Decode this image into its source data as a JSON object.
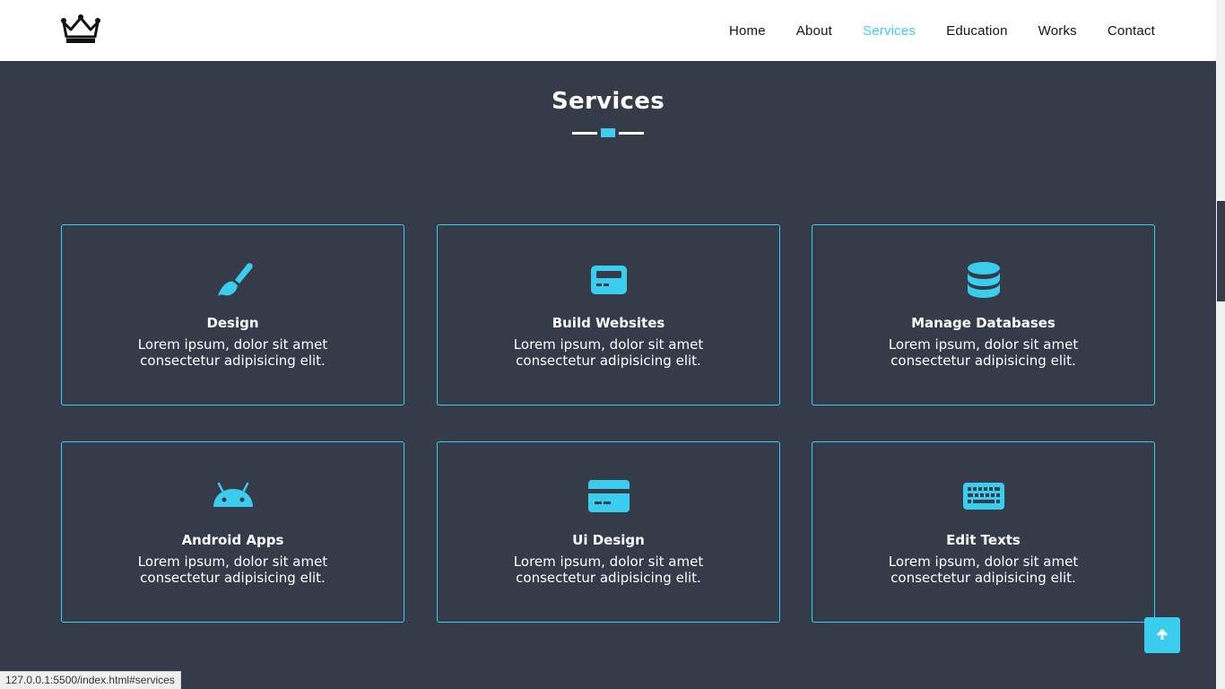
{
  "header": {
    "logo_icon": "crown-icon",
    "nav": [
      {
        "label": "Home",
        "active": false
      },
      {
        "label": "About",
        "active": false
      },
      {
        "label": "Services",
        "active": true
      },
      {
        "label": "Education",
        "active": false
      },
      {
        "label": "Works",
        "active": false
      },
      {
        "label": "Contact",
        "active": false
      }
    ]
  },
  "section": {
    "title": "Services"
  },
  "services": [
    {
      "icon": "paint-brush-icon",
      "title": "Design",
      "text": "Lorem ipsum, dolor sit amet consectetur adipisicing elit."
    },
    {
      "icon": "website-card-icon",
      "title": "Build Websites",
      "text": "Lorem ipsum, dolor sit amet consectetur adipisicing elit."
    },
    {
      "icon": "database-icon",
      "title": "Manage Databases",
      "text": "Lorem ipsum, dolor sit amet consectetur adipisicing elit."
    },
    {
      "icon": "android-icon",
      "title": "Android Apps",
      "text": "Lorem ipsum, dolor sit amet consectetur adipisicing elit."
    },
    {
      "icon": "credit-card-icon",
      "title": "Ui Design",
      "text": "Lorem ipsum, dolor sit amet consectetur adipisicing elit."
    },
    {
      "icon": "keyboard-icon",
      "title": "Edit Texts",
      "text": "Lorem ipsum, dolor sit amet consectetur adipisicing elit."
    }
  ],
  "back_to_top_icon": "arrow-up-icon",
  "status_bar": {
    "url": "127.0.0.1:5500/index.html#services"
  },
  "colors": {
    "accent": "#3bcdee",
    "background": "#363b49",
    "header_bg": "#ffffff"
  }
}
